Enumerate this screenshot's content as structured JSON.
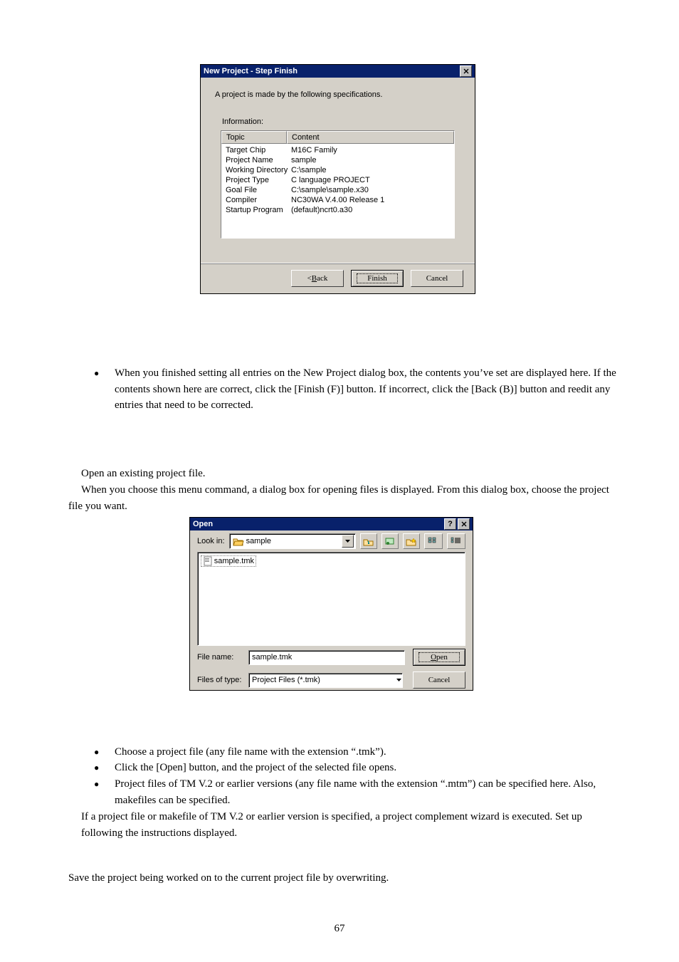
{
  "dlg1": {
    "title": "New Project - Step Finish",
    "intro": "A project is made by the following specifications.",
    "info_label": "Information:",
    "col_topic": "Topic",
    "col_content": "Content",
    "rows": [
      {
        "t": "Target Chip",
        "c": "M16C Family"
      },
      {
        "t": "Project Name",
        "c": "sample"
      },
      {
        "t": "Working Directory",
        "c": "C:\\sample"
      },
      {
        "t": "Project Type",
        "c": "C language PROJECT"
      },
      {
        "t": "Goal File",
        "c": "C:\\sample\\sample.x30"
      },
      {
        "t": "Compiler",
        "c": "NC30WA V.4.00 Release 1"
      },
      {
        "t": "Startup Program",
        "c": "(default)ncrt0.a30"
      }
    ],
    "btn_back_pre": "< ",
    "btn_back_u": "B",
    "btn_back_post": "ack",
    "btn_finish": "Finish",
    "btn_cancel": "Cancel"
  },
  "para1_a": "When you finished setting all entries on the New Project dialog box, the contents you",
  "para1_b": "ve set are displayed",
  "para1_c": "here. If the contents shown here are correct, click the [Finish (F)] button. If incorrect, click the [Back (B)] button and reedit any entries that need to be corrected.",
  "para2": "Open an existing project file.",
  "para3": "When you choose this menu command, a dialog box for opening files is displayed. From this dialog box, choose the project file you want.",
  "dlg2": {
    "title": "Open",
    "lookin_pre": "Look ",
    "lookin_u": "i",
    "lookin_post": "n:",
    "folder": "sample",
    "file": "sample.tmk",
    "fname_pre": "File ",
    "fname_u": "n",
    "fname_post": "ame:",
    "fname_val": "sample.tmk",
    "ftype_pre": "Files of ",
    "ftype_u": "t",
    "ftype_post": "ype:",
    "ftype_val": "Project Files (*.tmk)",
    "btn_open_u": "O",
    "btn_open_post": "pen",
    "btn_cancel": "Cancel"
  },
  "b1": "Choose a project file (any file name with the extension ",
  "b1_ext": ".tmk",
  "b1_end": ").",
  "b2": "Click the [Open] button, and the project of the selected file opens.",
  "b3": "Project files of TM V.2 or earlier versions (any file name with the extension ",
  "b3_ext": ".mtm",
  "b3_end": ") can be specified here. Also, makefiles can be specified.",
  "para4": "If a project file or makefile of TM V.2 or earlier version is specified, a project complement wizard is executed. Set up following the instructions displayed.",
  "para5": "Save the project being worked on to the current project file by overwriting.",
  "page_no": "67"
}
